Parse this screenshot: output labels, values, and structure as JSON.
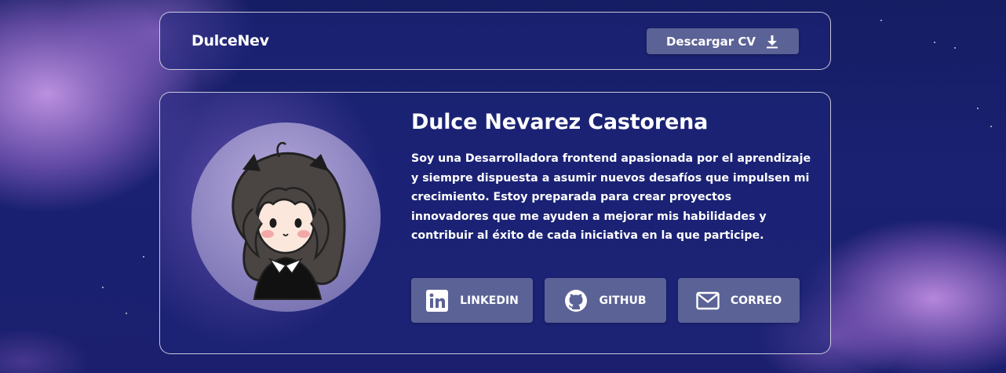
{
  "header": {
    "brand": "DulceNev",
    "download_label": "Descargar CV"
  },
  "profile": {
    "name": "Dulce Nevarez Castorena",
    "bio": "Soy una Desarrolladora frontend apasionada por el aprendizaje y siempre dispuesta a asumir nuevos desafíos que impulsen mi crecimiento. Estoy preparada para crear proyectos innovadores que me ayuden a mejorar mis habilidades y contribuir al éxito de cada iniciativa en la que participe."
  },
  "social": {
    "linkedin": {
      "label": "LINKEDIN",
      "icon": "linkedin-icon"
    },
    "github": {
      "label": "GITHUB",
      "icon": "github-icon"
    },
    "mail": {
      "label": "CORREO",
      "icon": "mail-icon"
    }
  },
  "colors": {
    "background": "#1a2172",
    "button": "#5b6296",
    "cloud": "#c496e6",
    "text": "#ffffff"
  }
}
